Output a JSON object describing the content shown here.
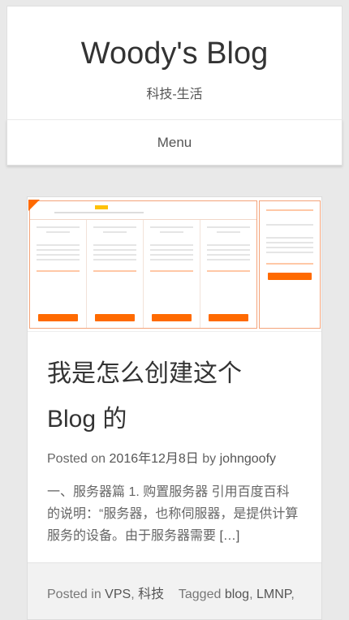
{
  "site": {
    "title": "Woody's Blog",
    "description": "科技-生活"
  },
  "nav": {
    "menu_label": "Menu"
  },
  "post": {
    "title_line1": "我是怎么创建这个",
    "title_line2": "Blog 的",
    "posted_on_label": "Posted on",
    "date": "2016年12月8日",
    "by_label": "by",
    "author": "johngoofy",
    "excerpt": "一、服务器篇 1. 购置服务器 引用百度百科的说明：“服务器，也称伺服器，是提供计算服务的设备。由于服务器需要",
    "more_link": "[…]",
    "posted_in_label": "Posted in",
    "categories": [
      "VPS",
      "科技"
    ],
    "tagged_label": "Tagged",
    "tags": [
      "blog",
      "LMNP"
    ]
  },
  "colors": {
    "accent": "#ff6a00",
    "background": "#e9e9e9"
  },
  "thumbnail": {
    "alt": "server hosting plans image"
  }
}
